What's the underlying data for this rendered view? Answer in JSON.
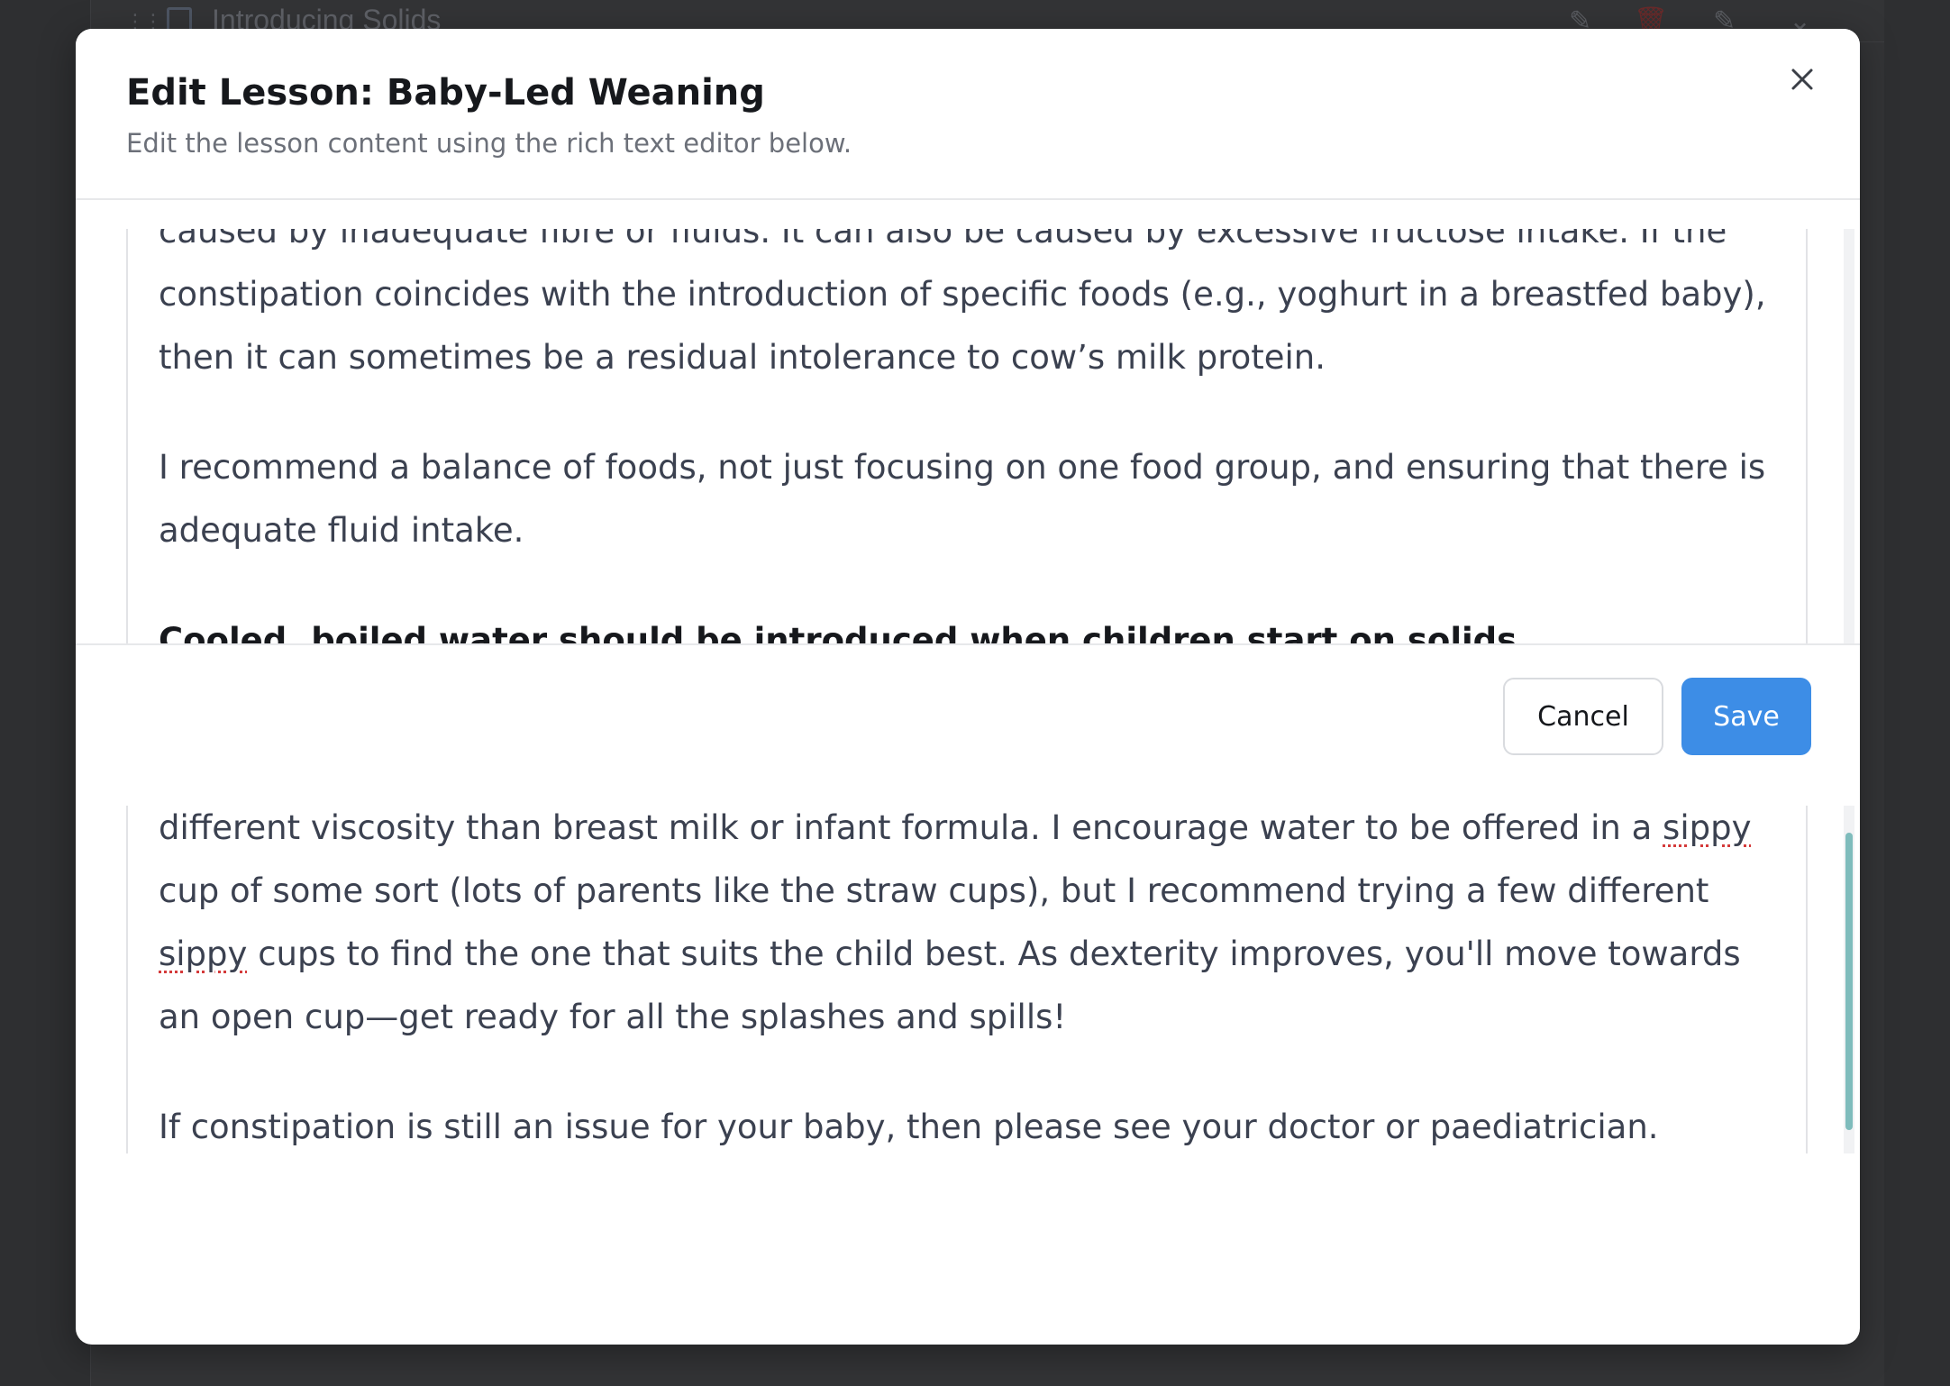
{
  "background": {
    "row_title": "Introducing Solids"
  },
  "modal": {
    "title": "Edit Lesson: Baby-Led Weaning",
    "subtitle": "Edit the lesson content using the rich text editor below.",
    "close_icon": "close-icon"
  },
  "editor": {
    "top_paragraphs": [
      "caused by inadequate fibre or fluids. It can also be caused by excessive fructose intake. If the constipation coincides with the introduction of specific foods (e.g., yoghurt in a breastfed baby), then it can sometimes be a residual intolerance to cow’s milk protein.",
      "I recommend a balance of foods, not just focusing on one food group, and ensuring that there is adequate fluid intake."
    ],
    "top_heading": "Cooled, boiled water should be introduced when children start on solids.",
    "bottom_p1_a": "different viscosity than breast milk or infant formula. I encourage water to be offered in a ",
    "bottom_p1_sippy1": "sippy",
    "bottom_p1_b": " cup of some sort (lots of parents like the straw cups), but I recommend trying a few different ",
    "bottom_p1_sippy2": "sippy",
    "bottom_p1_c": " cups to find the one that suits the child best. As dexterity improves, you'll move towards an open cup—get ready for all the splashes and spills!",
    "bottom_p2": "If constipation is still an issue for your baby, then please see your doctor or paediatrician."
  },
  "footer": {
    "cancel_label": "Cancel",
    "save_label": "Save"
  },
  "colors": {
    "save_button": "#3d8de6",
    "scroll_thumb": "#7fbcbc"
  }
}
